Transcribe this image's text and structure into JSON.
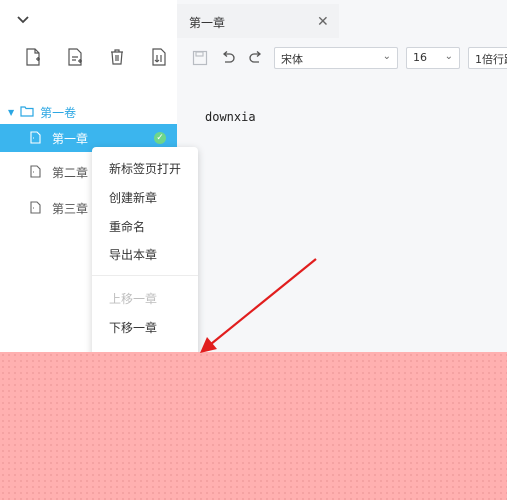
{
  "sidebar": {
    "volume_label": "第一卷",
    "chapters": [
      {
        "label": "第一章",
        "active": true
      },
      {
        "label": "第二章",
        "active": false
      },
      {
        "label": "第三章",
        "active": false
      }
    ],
    "icons": [
      "new-file-icon",
      "new-document-icon",
      "trash-icon",
      "import-icon"
    ]
  },
  "tab": {
    "title": "第一章",
    "close": "✕"
  },
  "toolbar": {
    "font_family": "宋体",
    "font_size": "16",
    "line_height": "1倍行距"
  },
  "editor": {
    "content": "downxia"
  },
  "context_menu": {
    "items": [
      "新标签页打开",
      "创建新章",
      "重命名",
      "导出本章"
    ],
    "move_up": "上移一章",
    "move_down": "下移一章"
  },
  "colors": {
    "accent": "#3bb5ee",
    "folder": "#2aa6e3",
    "success": "#6ed68b",
    "annotation": "#e11e1e"
  }
}
